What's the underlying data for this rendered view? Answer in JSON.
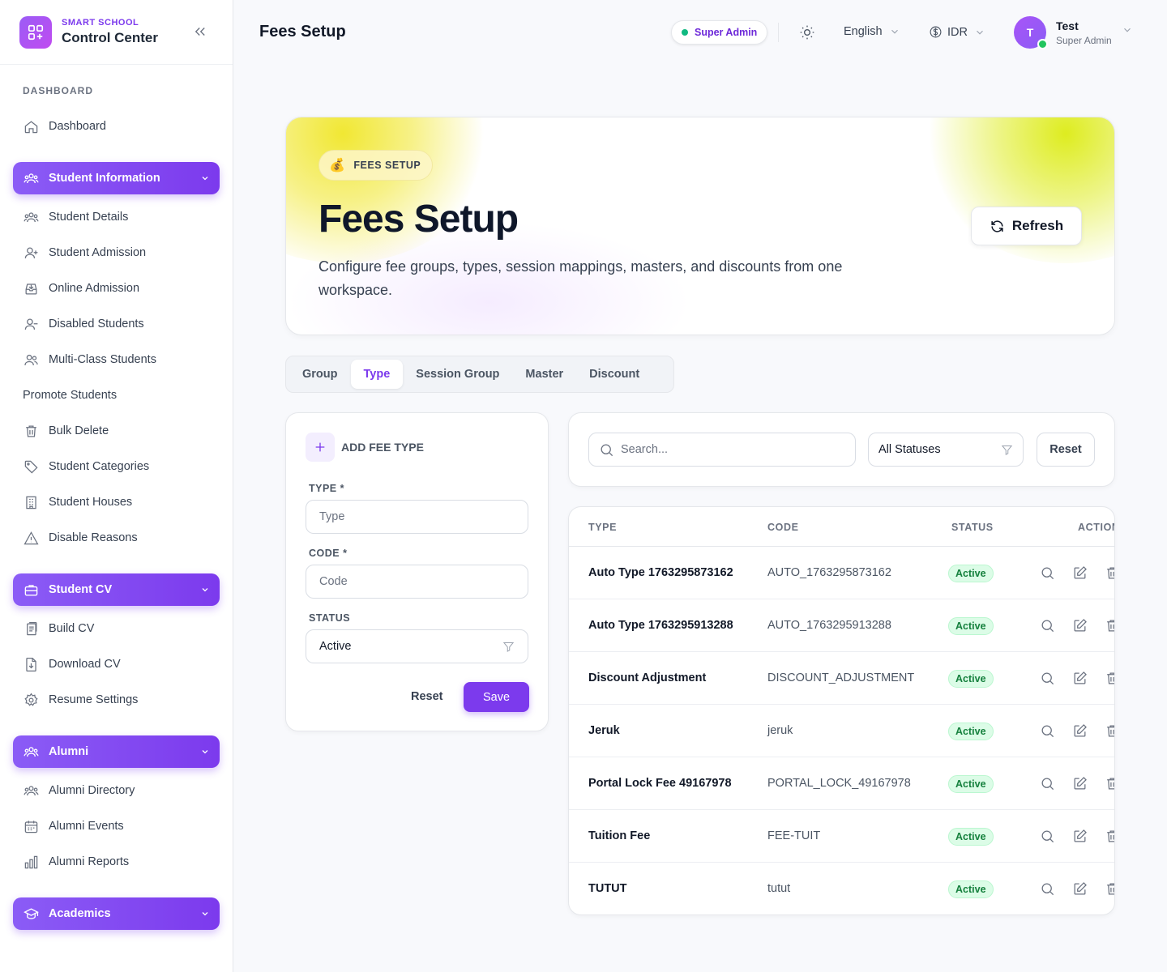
{
  "brand": {
    "small": "SMART SCHOOL",
    "big": "Control Center"
  },
  "sidebar": {
    "section": "DASHBOARD",
    "dashboard": "Dashboard",
    "groups": {
      "student_info": "Student Information",
      "student_cv": "Student CV",
      "alumni": "Alumni",
      "academics": "Academics"
    },
    "student_items": [
      "Student Details",
      "Student Admission",
      "Online Admission",
      "Disabled Students",
      "Multi-Class Students",
      "Promote Students",
      "Bulk Delete",
      "Student Categories",
      "Student Houses",
      "Disable Reasons"
    ],
    "cv_items": [
      "Build CV",
      "Download CV",
      "Resume Settings"
    ],
    "alumni_items": [
      "Alumni Directory",
      "Alumni Events",
      "Alumni Reports"
    ]
  },
  "header": {
    "title": "Fees Setup",
    "role_pill": "Super Admin",
    "language": "English",
    "currency": "IDR",
    "avatar_initial": "T",
    "user_name": "Test",
    "user_role": "Super Admin"
  },
  "hero": {
    "badge_emoji": "💰",
    "badge": "FEES SETUP",
    "title": "Fees Setup",
    "description": "Configure fee groups, types, session mappings, masters, and discounts from one workspace.",
    "refresh": "Refresh"
  },
  "tabs": [
    "Group",
    "Type",
    "Session Group",
    "Master",
    "Discount"
  ],
  "active_tab": "Type",
  "form": {
    "heading": "ADD FEE TYPE",
    "type_label": "TYPE *",
    "type_placeholder": "Type",
    "code_label": "CODE *",
    "code_placeholder": "Code",
    "status_label": "STATUS",
    "status_value": "Active",
    "reset": "Reset",
    "save": "Save"
  },
  "filters": {
    "search_placeholder": "Search...",
    "status": "All Statuses",
    "reset": "Reset"
  },
  "table": {
    "headers": {
      "type": "TYPE",
      "code": "CODE",
      "status": "STATUS",
      "actions": "ACTIONS"
    },
    "rows": [
      {
        "type": "Auto Type 1763295873162",
        "code": "AUTO_1763295873162",
        "status": "Active"
      },
      {
        "type": "Auto Type 1763295913288",
        "code": "AUTO_1763295913288",
        "status": "Active"
      },
      {
        "type": "Discount Adjustment",
        "code": "DISCOUNT_ADJUSTMENT",
        "status": "Active"
      },
      {
        "type": "Jeruk",
        "code": "jeruk",
        "status": "Active"
      },
      {
        "type": "Portal Lock Fee 49167978",
        "code": "PORTAL_LOCK_49167978",
        "status": "Active"
      },
      {
        "type": "Tuition Fee",
        "code": "FEE-TUIT",
        "status": "Active"
      },
      {
        "type": "TUTUT",
        "code": "tutut",
        "status": "Active"
      }
    ]
  },
  "colors": {
    "accent": "#7c3aed",
    "success": "#15803d",
    "hero_glow": "#f0e628"
  }
}
